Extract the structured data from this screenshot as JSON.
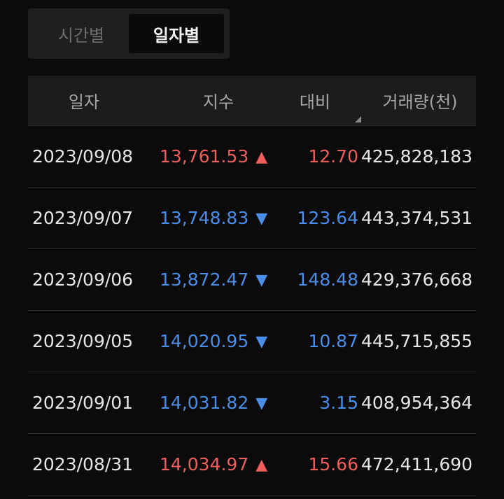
{
  "toggle": {
    "options": [
      "시간별",
      "일자별"
    ],
    "selected": 1
  },
  "table": {
    "headers": {
      "date": "일자",
      "index": "지수",
      "diff": "대비",
      "volume": "거래량(천)"
    },
    "rows": [
      {
        "date": "2023/09/08",
        "index": "13,761.53",
        "direction": "up",
        "arrow": "▲",
        "diff": "12.70",
        "volume": "425,828,183"
      },
      {
        "date": "2023/09/07",
        "index": "13,748.83",
        "direction": "down",
        "arrow": "▼",
        "diff": "123.64",
        "volume": "443,374,531"
      },
      {
        "date": "2023/09/06",
        "index": "13,872.47",
        "direction": "down",
        "arrow": "▼",
        "diff": "148.48",
        "volume": "429,376,668"
      },
      {
        "date": "2023/09/05",
        "index": "14,020.95",
        "direction": "down",
        "arrow": "▼",
        "diff": "10.87",
        "volume": "445,715,855"
      },
      {
        "date": "2023/09/01",
        "index": "14,031.82",
        "direction": "down",
        "arrow": "▼",
        "diff": "3.15",
        "volume": "408,954,364"
      },
      {
        "date": "2023/08/31",
        "index": "14,034.97",
        "direction": "up",
        "arrow": "▲",
        "diff": "15.66",
        "volume": "472,411,690"
      }
    ]
  },
  "colors": {
    "background": "#0b0b0b",
    "up": "#f05d5d",
    "down": "#4a8dea",
    "text": "#e6e6e6",
    "header_text": "#a6a6a6"
  }
}
